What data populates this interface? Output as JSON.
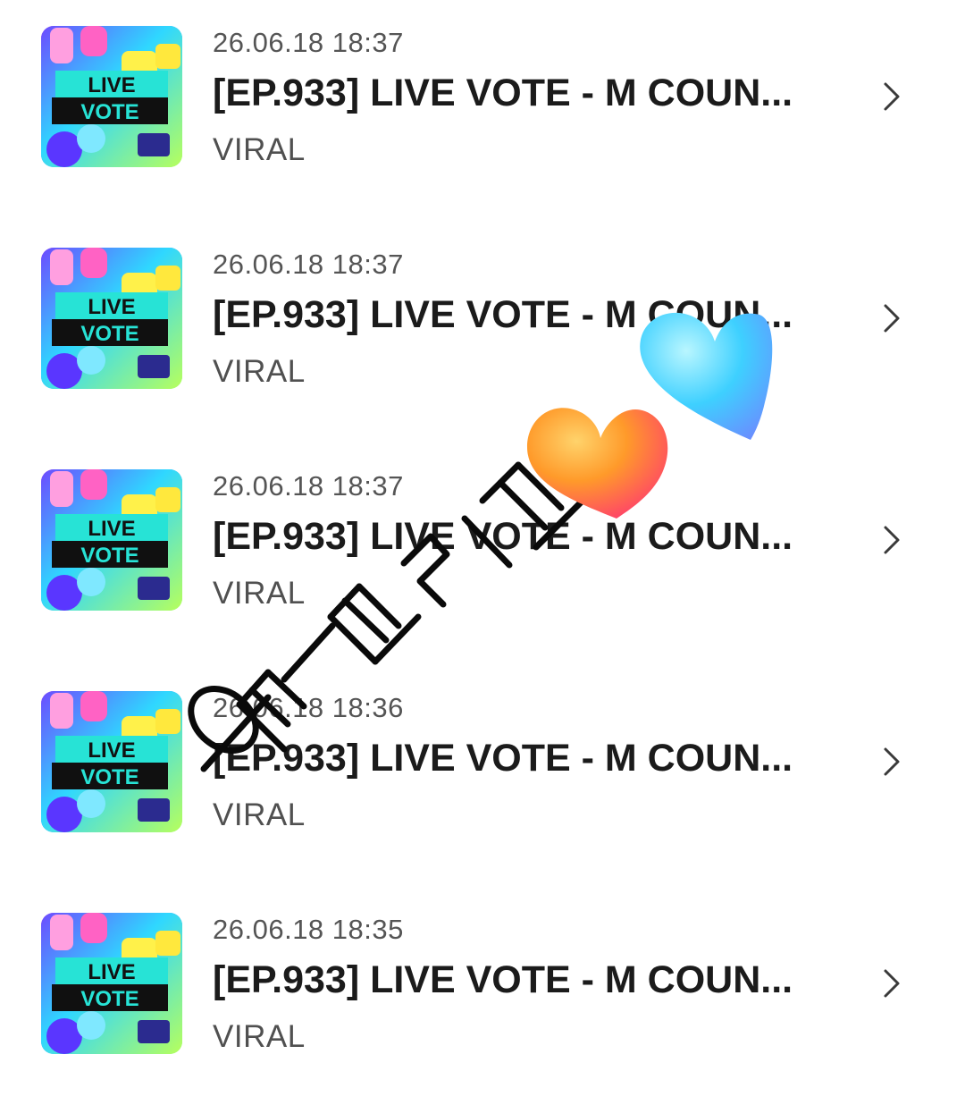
{
  "items": [
    {
      "date": "26.06.18 18:37",
      "title": "[EP.933] LIVE VOTE - M COUN...",
      "category": "VIRAL",
      "thumb_text": [
        "LIVE",
        "VOTE"
      ]
    },
    {
      "date": "26.06.18 18:37",
      "title": "[EP.933] LIVE VOTE - M COUN...",
      "category": "VIRAL",
      "thumb_text": [
        "LIVE",
        "VOTE"
      ]
    },
    {
      "date": "26.06.18 18:37",
      "title": "[EP.933] LIVE VOTE - M COUN...",
      "category": "VIRAL",
      "thumb_text": [
        "LIVE",
        "VOTE"
      ]
    },
    {
      "date": "26.06.18 18:36",
      "title": "[EP.933] LIVE VOTE - M COUN...",
      "category": "VIRAL",
      "thumb_text": [
        "LIVE",
        "VOTE"
      ]
    },
    {
      "date": "26.06.18 18:35",
      "title": "[EP.933] LIVE VOTE - M COUN...",
      "category": "VIRAL",
      "thumb_text": [
        "LIVE",
        "VOTE"
      ]
    }
  ],
  "overlay": {
    "handwriting": "오트 브리즈",
    "stickers": [
      "orange-heart-emoji",
      "light-blue-heart-emoji"
    ]
  },
  "colors": {
    "text_primary": "#1b1b1b",
    "text_secondary": "#555555",
    "chevron": "#3a3a3a",
    "heart_orange": "#ff8a1f",
    "heart_blue": "#4fd3ff"
  }
}
